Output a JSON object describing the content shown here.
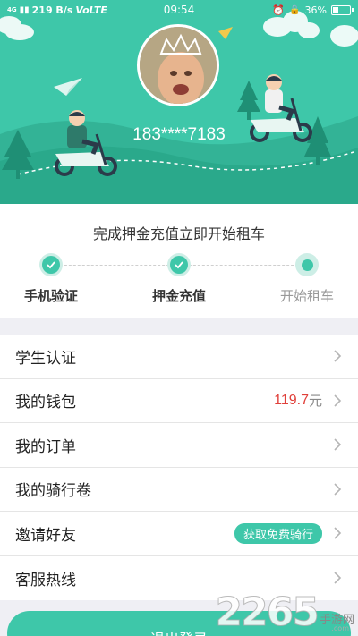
{
  "status_bar": {
    "signal": "4G",
    "speed": "219 B/s",
    "network": "VoLTE",
    "time": "09:54",
    "battery": "36%",
    "battery_level": 0.36
  },
  "profile": {
    "phone": "183****7183"
  },
  "progress": {
    "title": "完成押金充值立即开始租车",
    "steps": [
      {
        "label": "手机验证",
        "status": "done"
      },
      {
        "label": "押金充值",
        "status": "done"
      },
      {
        "label": "开始租车",
        "status": "pending"
      }
    ]
  },
  "menu": {
    "student": {
      "label": "学生认证"
    },
    "wallet": {
      "label": "我的钱包",
      "amount": "119.7",
      "unit": "元"
    },
    "orders": {
      "label": "我的订单"
    },
    "vouchers": {
      "label": "我的骑行卷"
    },
    "invite": {
      "label": "邀请好友",
      "badge": "获取免费骑行"
    },
    "service": {
      "label": "客服热线"
    }
  },
  "logout": {
    "label": "退出登录"
  },
  "watermark": {
    "number": "2265",
    "text": "手游网",
    "sub": ".com"
  },
  "colors": {
    "accent": "#3ec7a9",
    "money": "#e0403a"
  }
}
